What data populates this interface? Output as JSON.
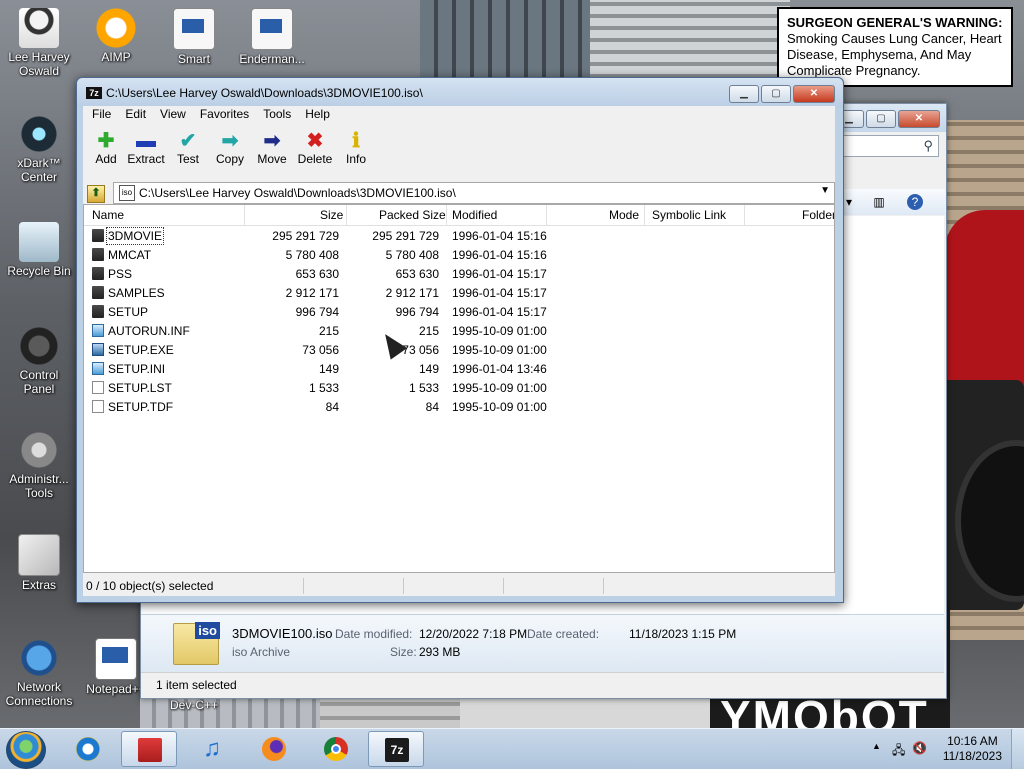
{
  "desktop": {
    "icons": [
      {
        "label": "Lee Harvey Oswald",
        "icon": "user-icon"
      },
      {
        "label": "AIMP",
        "icon": "aimp-icon"
      },
      {
        "label": "Smart",
        "icon": "document-icon"
      },
      {
        "label": "Enderman...",
        "icon": "document-icon"
      },
      {
        "label": "xDark™ Center",
        "icon": "xdark-icon"
      },
      {
        "label": "Recycle Bin",
        "icon": "recycle-bin-icon"
      },
      {
        "label": "Control Panel",
        "icon": "control-panel-icon"
      },
      {
        "label": "Administr... Tools",
        "icon": "admin-tools-icon"
      },
      {
        "label": "Extras",
        "icon": "extras-icon"
      },
      {
        "label": "Network Connections",
        "icon": "network-icon"
      },
      {
        "label": "Notepad++",
        "icon": "notepad-icon"
      },
      {
        "label": "Dev-C++",
        "icon": "devcpp-icon"
      }
    ]
  },
  "wallpaper": {
    "warning_heading": "SURGEON GENERAL'S WARNING:",
    "warning_text": "Smoking Causes Lung Cancer, Heart Disease, Emphysema, And May Complicate Pregnancy.",
    "big_text": "YMObOT"
  },
  "explorer": {
    "file_name": "3DMOVIE100.iso",
    "file_type": "iso Archive",
    "date_modified_label": "Date modified:",
    "date_modified": "12/20/2022 7:18 PM",
    "date_created_label": "Date created:",
    "date_created": "11/18/2023 1:15 PM",
    "size_label": "Size:",
    "size": "293 MB",
    "status": "1 item selected",
    "icon_badge": "iso"
  },
  "zip": {
    "app_icon": "7z",
    "title": "C:\\Users\\Lee Harvey Oswald\\Downloads\\3DMOVIE100.iso\\",
    "menu": [
      "File",
      "Edit",
      "View",
      "Favorites",
      "Tools",
      "Help"
    ],
    "toolbar": [
      {
        "label": "Add",
        "icon": "add-icon",
        "glyph": "✚",
        "color": "#2eaa2e"
      },
      {
        "label": "Extract",
        "icon": "extract-icon",
        "glyph": "▬",
        "color": "#1f3db5"
      },
      {
        "label": "Test",
        "icon": "test-icon",
        "glyph": "✔",
        "color": "#21a5a5"
      },
      {
        "label": "Copy",
        "icon": "copy-icon",
        "glyph": "➡",
        "color": "#21a5a5"
      },
      {
        "label": "Move",
        "icon": "move-icon",
        "glyph": "➡",
        "color": "#1f2c8a"
      },
      {
        "label": "Delete",
        "icon": "delete-icon",
        "glyph": "✖",
        "color": "#d21f1f"
      },
      {
        "label": "Info",
        "icon": "info-icon",
        "glyph": "ℹ",
        "color": "#d8b400"
      }
    ],
    "address": "C:\\Users\\Lee Harvey Oswald\\Downloads\\3DMOVIE100.iso\\",
    "columns": [
      "Name",
      "Size",
      "Packed Size",
      "Modified",
      "Mode",
      "Symbolic Link",
      "Folder"
    ],
    "rows": [
      {
        "name": "3DMOVIE",
        "size": "295 291 729",
        "packed": "295 291 729",
        "modified": "1996-01-04 15:16",
        "type": "folder"
      },
      {
        "name": "MMCAT",
        "size": "5 780 408",
        "packed": "5 780 408",
        "modified": "1996-01-04 15:16",
        "type": "folder"
      },
      {
        "name": "PSS",
        "size": "653 630",
        "packed": "653 630",
        "modified": "1996-01-04 15:17",
        "type": "folder"
      },
      {
        "name": "SAMPLES",
        "size": "2 912 171",
        "packed": "2 912 171",
        "modified": "1996-01-04 15:17",
        "type": "folder"
      },
      {
        "name": "SETUP",
        "size": "996 794",
        "packed": "996 794",
        "modified": "1996-01-04 15:17",
        "type": "folder"
      },
      {
        "name": "AUTORUN.INF",
        "size": "215",
        "packed": "215",
        "modified": "1995-10-09 01:00",
        "type": "inf"
      },
      {
        "name": "SETUP.EXE",
        "size": "73 056",
        "packed": "73 056",
        "modified": "1995-10-09 01:00",
        "type": "exe"
      },
      {
        "name": "SETUP.INI",
        "size": "149",
        "packed": "149",
        "modified": "1996-01-04 13:46",
        "type": "inf"
      },
      {
        "name": "SETUP.LST",
        "size": "1 533",
        "packed": "1 533",
        "modified": "1995-10-09 01:00",
        "type": "txt"
      },
      {
        "name": "SETUP.TDF",
        "size": "84",
        "packed": "84",
        "modified": "1995-10-09 01:00",
        "type": "txt"
      }
    ],
    "status": "0 / 10 object(s) selected"
  },
  "taskbar": {
    "items": [
      "start-orb",
      "internet-explorer",
      "store",
      "music",
      "firefox",
      "chrome",
      "7-zip"
    ],
    "time": "10:16 AM",
    "date": "11/18/2023"
  }
}
